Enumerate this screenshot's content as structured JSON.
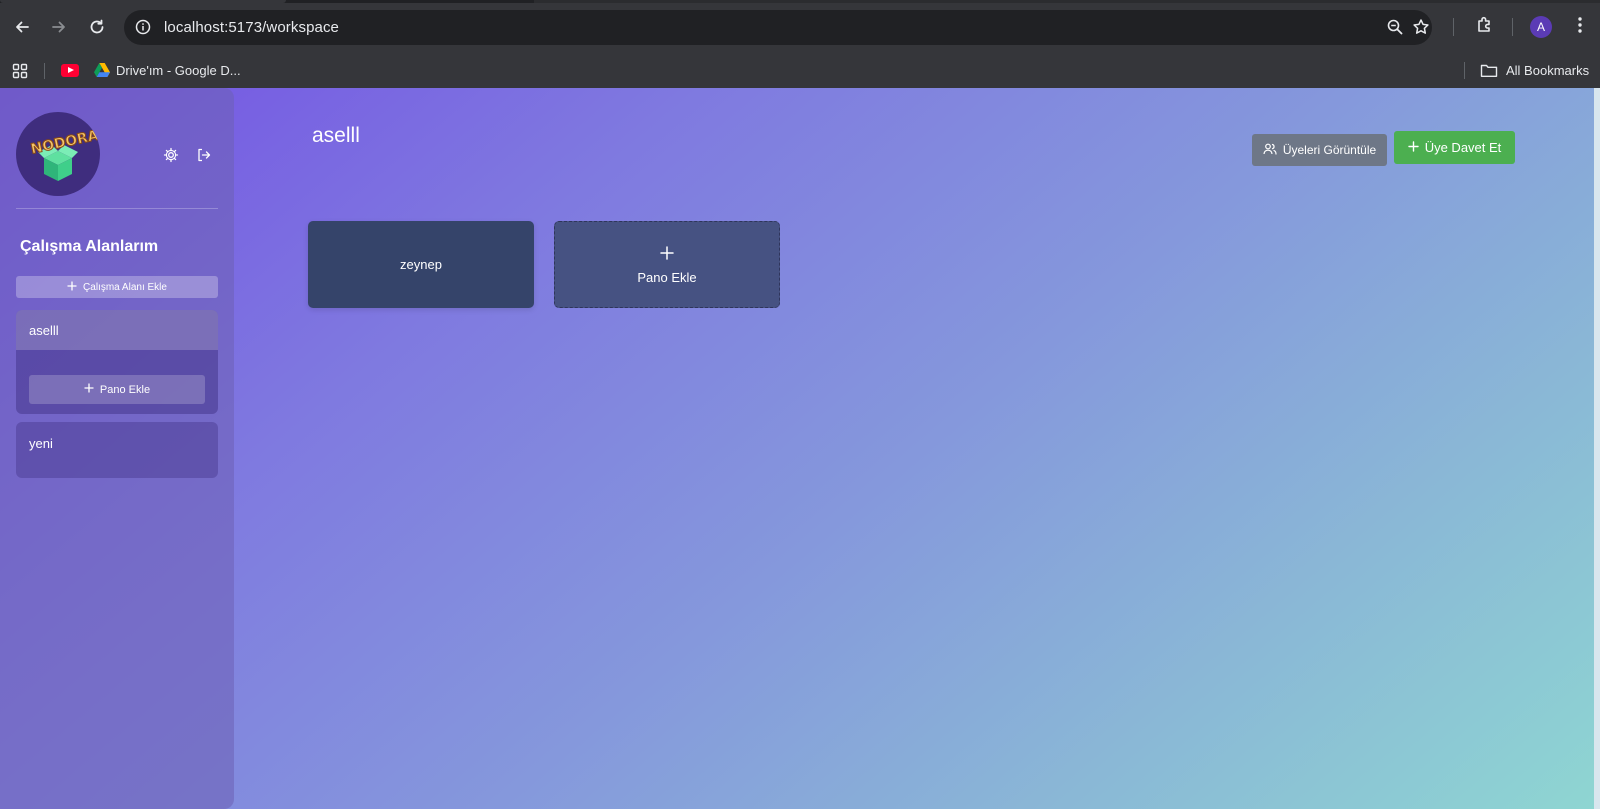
{
  "browser": {
    "url": "localhost:5173/workspace",
    "profile_initial": "A",
    "bookmarks": {
      "drive_label": "Drive'ım - Google D...",
      "all_bookmarks_label": "All Bookmarks"
    }
  },
  "sidebar": {
    "logo_text": "NODORA",
    "title": "Çalışma Alanlarım",
    "add_workspace_label": "Çalışma Alanı Ekle",
    "workspaces": [
      {
        "name": "aselll",
        "add_board_label": "Pano Ekle"
      },
      {
        "name": "yeni"
      }
    ]
  },
  "main": {
    "workspace_title": "aselll",
    "view_members_label": "Üyeleri Görüntüle",
    "invite_member_label": "Üye Davet Et",
    "boards": [
      {
        "name": "zeynep"
      }
    ],
    "add_board_label": "Pano Ekle"
  },
  "colors": {
    "invite_button": "#4caf50",
    "members_button": "#6e7787",
    "board_card": "#35446a",
    "gradient_start": "#7352e3",
    "gradient_end": "#8ed6d2"
  }
}
